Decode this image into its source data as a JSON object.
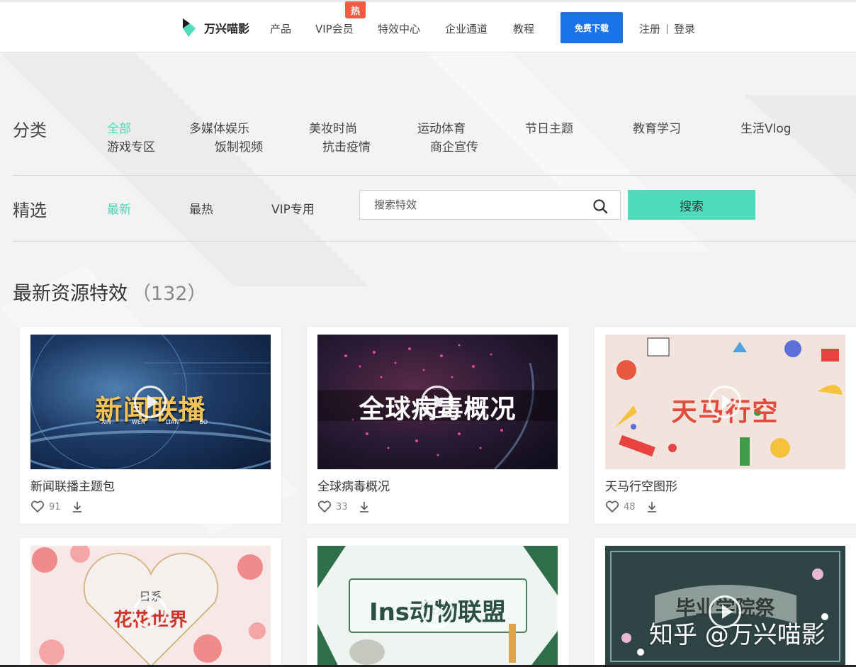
{
  "header": {
    "brand": "万兴喵影",
    "nav": [
      "产品",
      "VIP会员",
      "特效中心",
      "企业通道",
      "教程"
    ],
    "hot_badge": "热",
    "download_label": "免费下载",
    "register": "注册",
    "login": "登录"
  },
  "filters": {
    "category_label": "分类",
    "categories": [
      "全部",
      "多媒体娱乐",
      "美妆时尚",
      "运动体育",
      "节日主题",
      "教育学习",
      "生活Vlog",
      "游戏专区",
      "饭制视频",
      "抗击疫情",
      "商企宣传"
    ],
    "pick_label": "精选",
    "picks": [
      "最新",
      "最热",
      "VIP专用"
    ],
    "search_placeholder": "搜索特效",
    "search_button": "搜索"
  },
  "section": {
    "title": "最新资源特效",
    "count": "（132）"
  },
  "cards": [
    {
      "name": "新闻联播主题包",
      "likes": "91",
      "thumb_title": "新闻联播",
      "thumb_sub": [
        "XIN",
        "WEN",
        "LIAN",
        "BO"
      ]
    },
    {
      "name": "全球病毒概况",
      "likes": "33",
      "thumb_title": "全球病毒概况"
    },
    {
      "name": "天马行空图形",
      "likes": "48",
      "thumb_title": "天马行空"
    },
    {
      "name": "",
      "thumb_title": "花花世界",
      "thumb_sub": "日系"
    },
    {
      "name": "",
      "thumb_title": "Ins动物联盟"
    },
    {
      "name": "",
      "thumb_title": "毕业学院祭"
    }
  ],
  "watermark": "知乎 @万兴喵影",
  "colors": {
    "accent": "#4cd6b4",
    "download": "#1a73e8",
    "hot": "#f25a43",
    "search_btn": "#4fdcbc"
  }
}
